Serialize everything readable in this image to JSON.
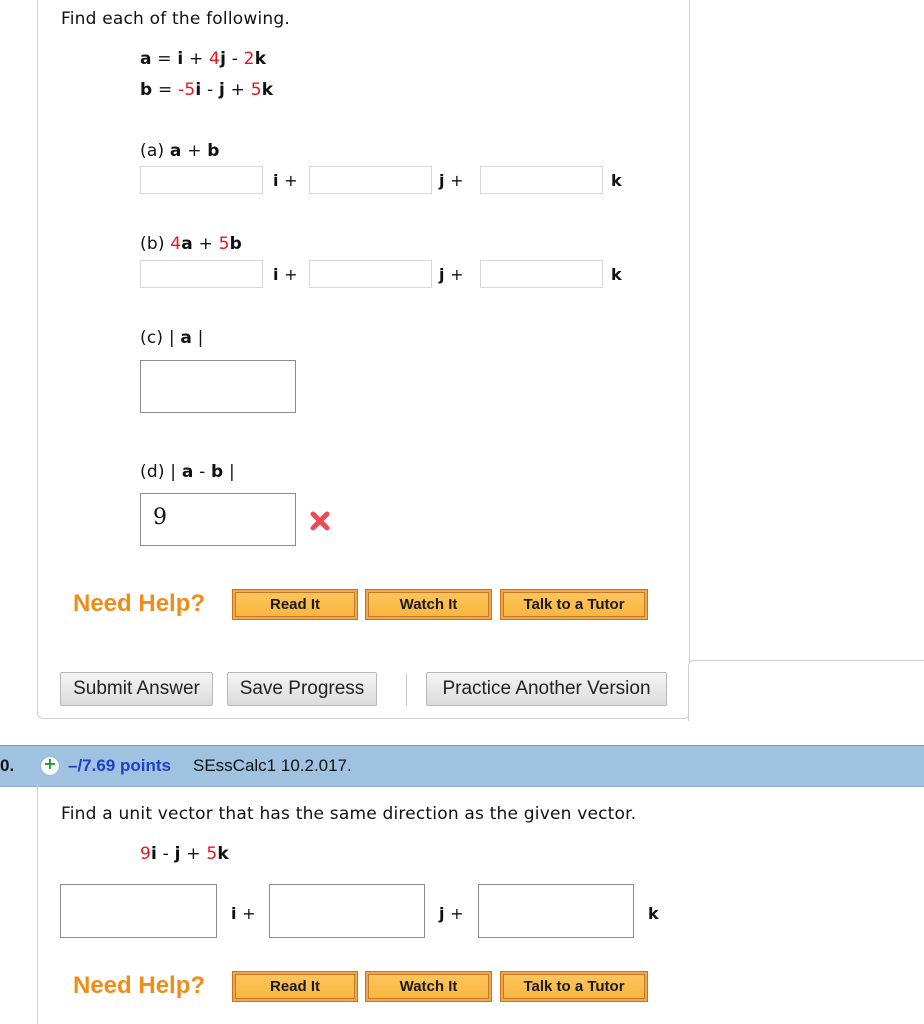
{
  "question9": {
    "prompt": "Find each of the following.",
    "vector_a": {
      "name": "a",
      "eq": "=",
      "terms": [
        "i",
        "+",
        "4",
        "j",
        "-",
        "2",
        "k"
      ]
    },
    "vector_b": {
      "name": "b",
      "eq": "=",
      "terms": [
        "-5",
        "i",
        "-",
        "j",
        "+",
        "5",
        "k"
      ]
    },
    "parts": [
      {
        "label": "(a)",
        "expr": [
          "a",
          "+",
          "b"
        ],
        "fields": [
          "",
          "",
          ""
        ]
      },
      {
        "label": "(b)",
        "expr": [
          "4",
          "a",
          "+",
          "5",
          "b"
        ],
        "fields": [
          "",
          "",
          ""
        ]
      },
      {
        "label": "(c)",
        "expr": [
          "|",
          "a",
          "|"
        ],
        "value": ""
      },
      {
        "label": "(d)",
        "expr": [
          "|",
          "a",
          "-",
          "b",
          "|"
        ],
        "value": "9",
        "status": "incorrect"
      }
    ],
    "units": {
      "i": "i",
      "j": "j",
      "k": "k",
      "plus": "+"
    },
    "help": {
      "label": "Need Help?",
      "read": "Read It",
      "watch": "Watch It",
      "tutor": "Talk to a Tutor"
    },
    "actions": {
      "submit": "Submit Answer",
      "save": "Save Progress",
      "practice": "Practice Another Version"
    }
  },
  "question10": {
    "number": "0.",
    "points": "–/7.69 points",
    "source": "SEssCalc1 10.2.017.",
    "prompt": "Find a unit vector that has the same direction as the given vector.",
    "vector": {
      "terms": [
        "9",
        "i",
        "-",
        "j",
        "+",
        "5",
        "k"
      ]
    },
    "fields": [
      "",
      "",
      ""
    ],
    "help": {
      "label": "Need Help?",
      "read": "Read It",
      "watch": "Watch It",
      "tutor": "Talk to a Tutor"
    }
  },
  "colors": {
    "coefficient": "#e8141a",
    "help": "#f08c18",
    "points": "#1f3fc4",
    "header_bar": "#9fc2e0"
  }
}
